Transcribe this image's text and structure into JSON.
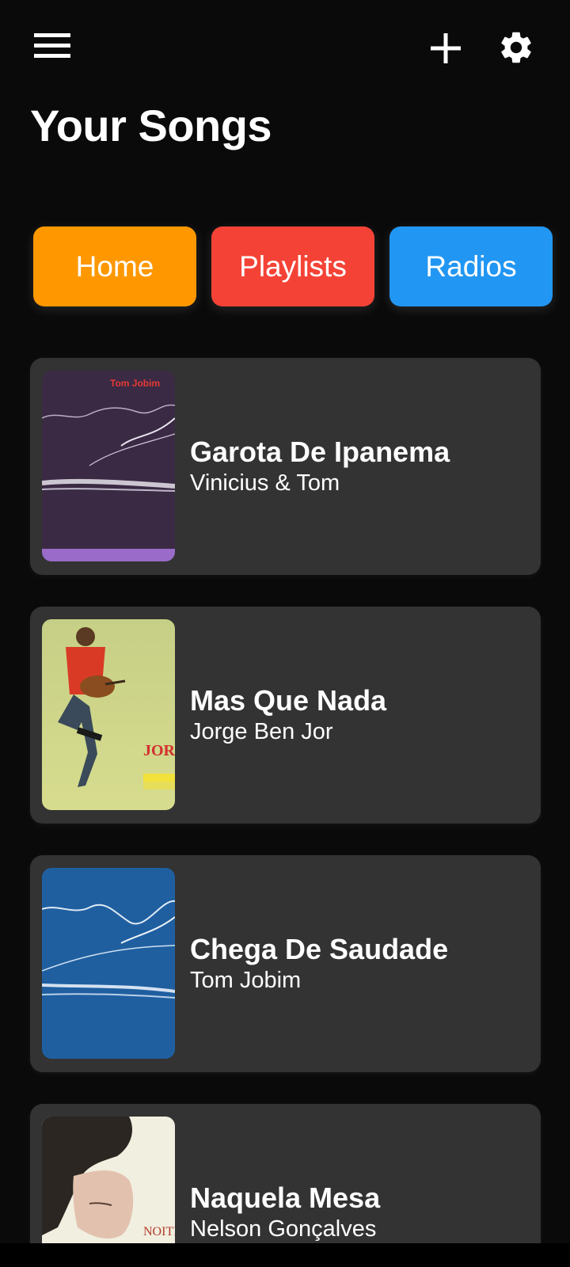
{
  "header": {
    "title": "Your Songs",
    "menu_icon": "hamburger-menu-icon",
    "add_icon": "plus-icon",
    "settings_icon": "gear-icon"
  },
  "categories": [
    {
      "label": "Home",
      "color": "#ff9800"
    },
    {
      "label": "Playlists",
      "color": "#f44336"
    },
    {
      "label": "Radios",
      "color": "#2196f3"
    }
  ],
  "songs": [
    {
      "title": "Garota De Ipanema",
      "artist": "Vinicius & Tom",
      "cover_text": "Tom Jobim"
    },
    {
      "title": "Mas Que Nada",
      "artist": "Jorge Ben Jor",
      "cover_text": "JORGE BEN"
    },
    {
      "title": "Chega De Saudade",
      "artist": "Tom Jobim"
    },
    {
      "title": "Naquela Mesa",
      "artist": "Nelson Gonçalves",
      "cover_text": "NOITE"
    }
  ],
  "colors": {
    "background": "#0a0a0a",
    "card": "#333333",
    "text": "#ffffff"
  }
}
